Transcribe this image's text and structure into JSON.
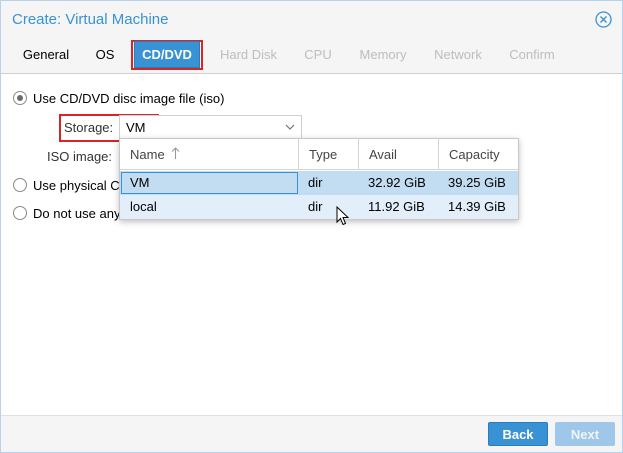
{
  "window": {
    "title": "Create: Virtual Machine",
    "accent_color": "#3892d4",
    "highlight_color": "#d92526"
  },
  "tabs": [
    {
      "label": "General",
      "state": "enabled"
    },
    {
      "label": "OS",
      "state": "enabled"
    },
    {
      "label": "CD/DVD",
      "state": "active"
    },
    {
      "label": "Hard Disk",
      "state": "disabled"
    },
    {
      "label": "CPU",
      "state": "disabled"
    },
    {
      "label": "Memory",
      "state": "disabled"
    },
    {
      "label": "Network",
      "state": "disabled"
    },
    {
      "label": "Confirm",
      "state": "disabled"
    }
  ],
  "options": {
    "iso": {
      "label": "Use CD/DVD disc image file (iso)",
      "checked": true
    },
    "physical": {
      "label": "Use physical C",
      "checked": false
    },
    "none": {
      "label": "Do not use any",
      "checked": false
    }
  },
  "storage": {
    "label": "Storage:",
    "value": "VM"
  },
  "iso_image": {
    "label": "ISO image:"
  },
  "storage_dropdown": {
    "columns": {
      "name": "Name",
      "sort_icon": "sort-ascending-icon",
      "type": "Type",
      "avail": "Avail",
      "capacity": "Capacity"
    },
    "rows": [
      {
        "name": "VM",
        "type": "dir",
        "avail": "32.92 GiB",
        "capacity": "39.25 GiB"
      },
      {
        "name": "local",
        "type": "dir",
        "avail": "11.92 GiB",
        "capacity": "14.39 GiB"
      }
    ]
  },
  "footer": {
    "back_label": "Back",
    "next_label": "Next"
  }
}
